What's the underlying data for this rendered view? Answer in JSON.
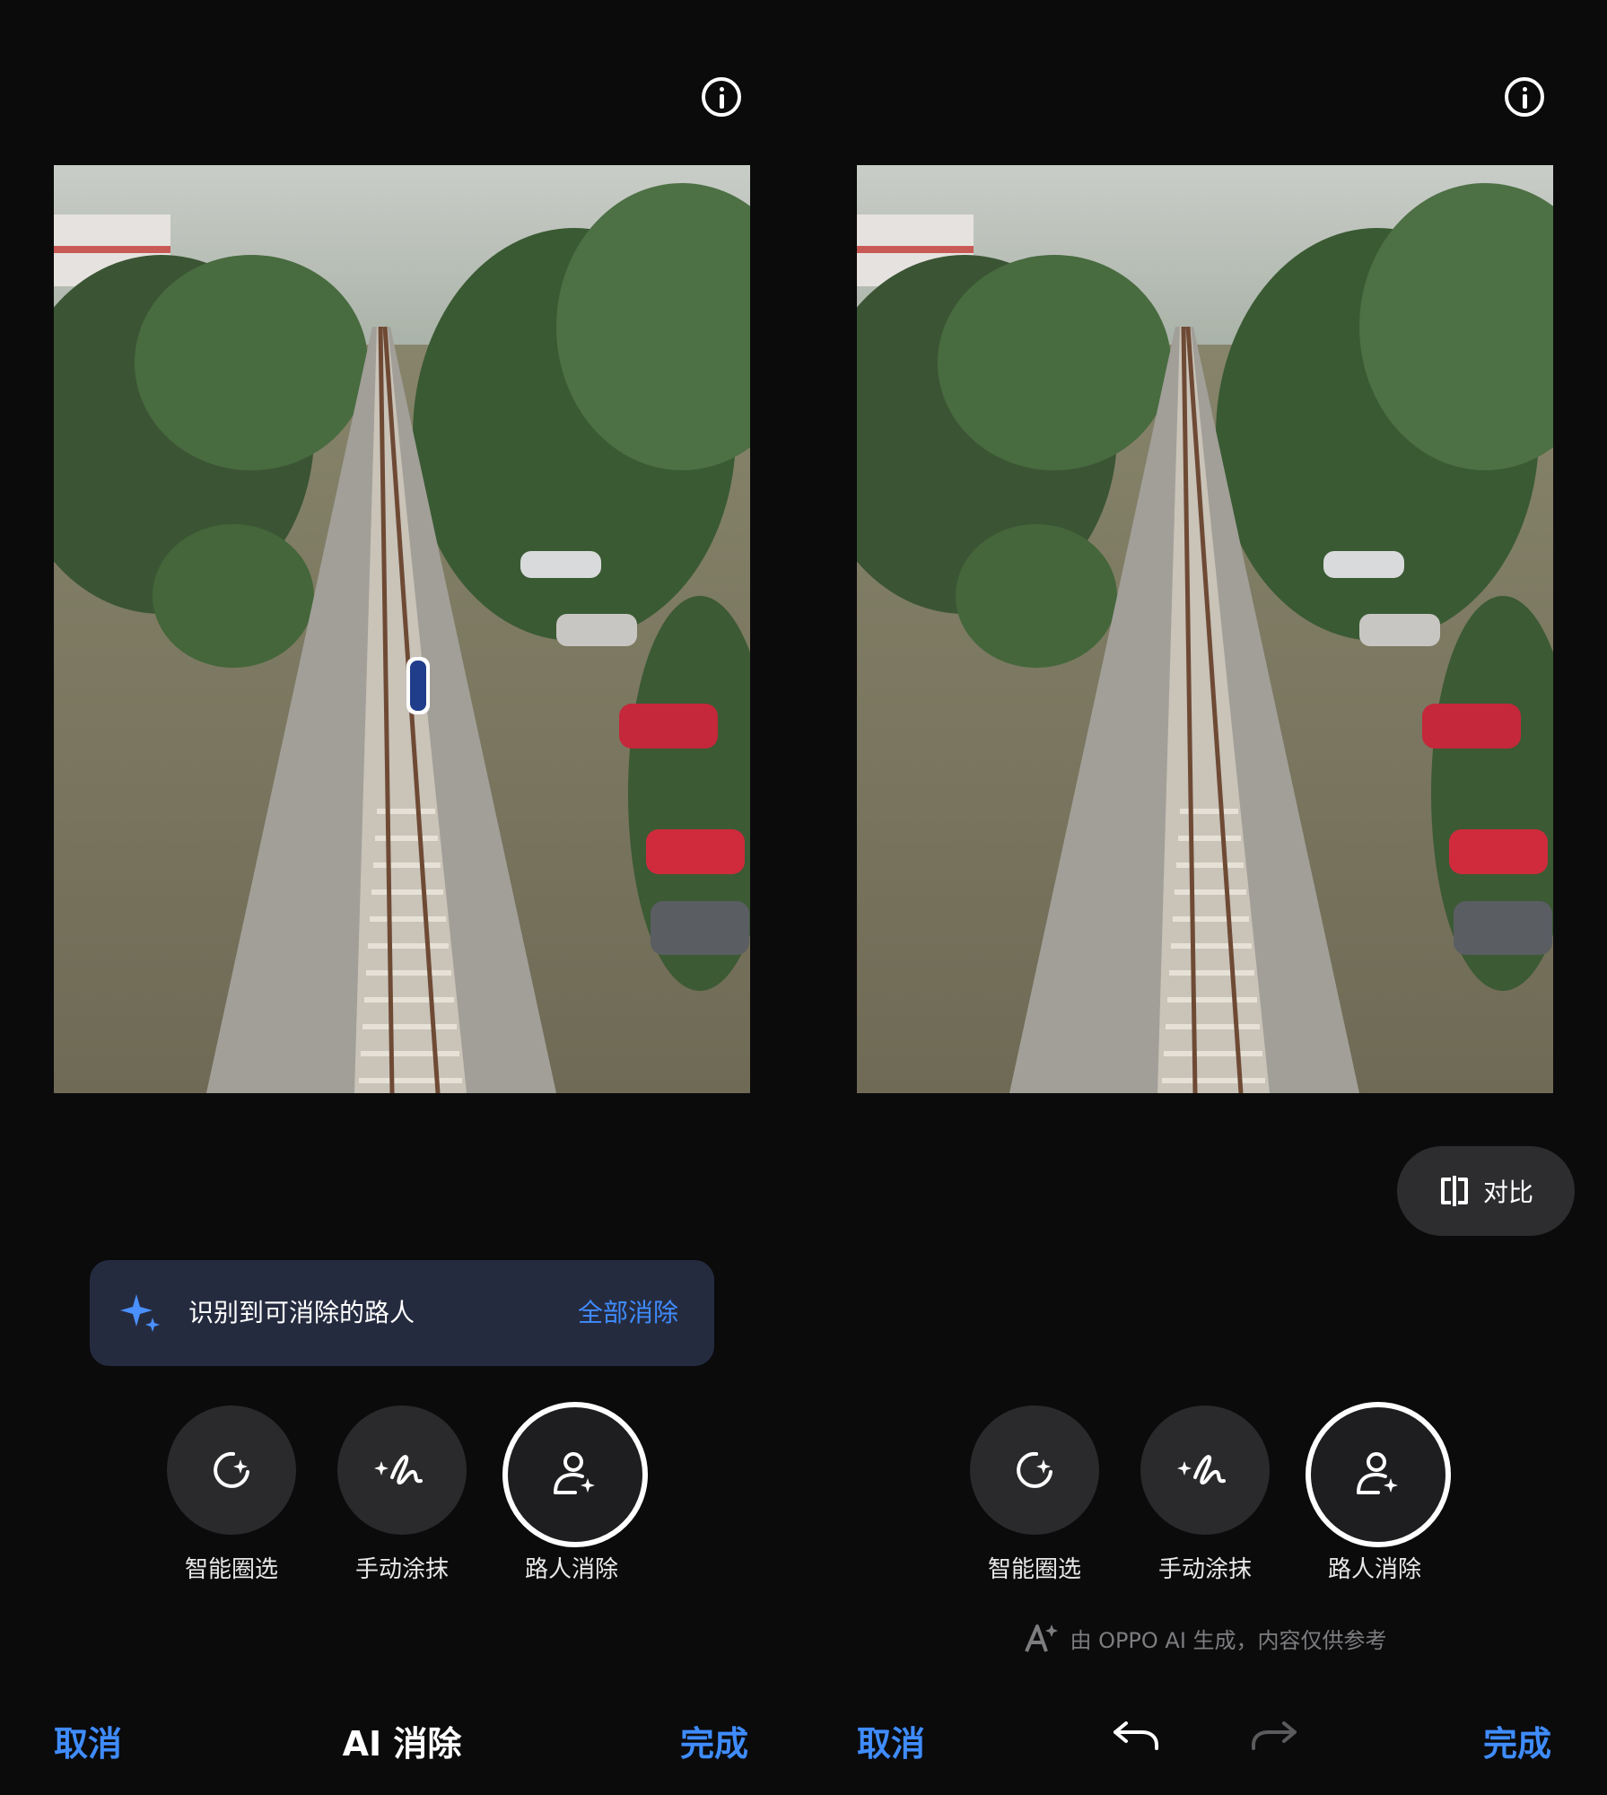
{
  "left_screen": {
    "banner": {
      "message": "识别到可消除的路人",
      "action": "全部消除"
    },
    "tools": [
      {
        "label": "智能圈选",
        "icon": "smart-select-icon"
      },
      {
        "label": "手动涂抹",
        "icon": "manual-brush-icon"
      },
      {
        "label": "路人消除",
        "icon": "passerby-remove-icon",
        "active": true
      }
    ],
    "bottom_bar": {
      "cancel": "取消",
      "title": "AI 消除",
      "done": "完成"
    }
  },
  "right_screen": {
    "compare_label": "对比",
    "tools": [
      {
        "label": "智能圈选",
        "icon": "smart-select-icon"
      },
      {
        "label": "手动涂抹",
        "icon": "manual-brush-icon"
      },
      {
        "label": "路人消除",
        "icon": "passerby-remove-icon",
        "active": true
      }
    ],
    "disclaimer": "由 OPPO AI 生成，内容仅供参考",
    "bottom_bar": {
      "cancel": "取消",
      "done": "完成"
    }
  },
  "colors": {
    "background": "#0b0b0c",
    "accent": "#3f8cff",
    "banner_bg": "#252b3f",
    "tool_bg": "#2a2a2c"
  }
}
